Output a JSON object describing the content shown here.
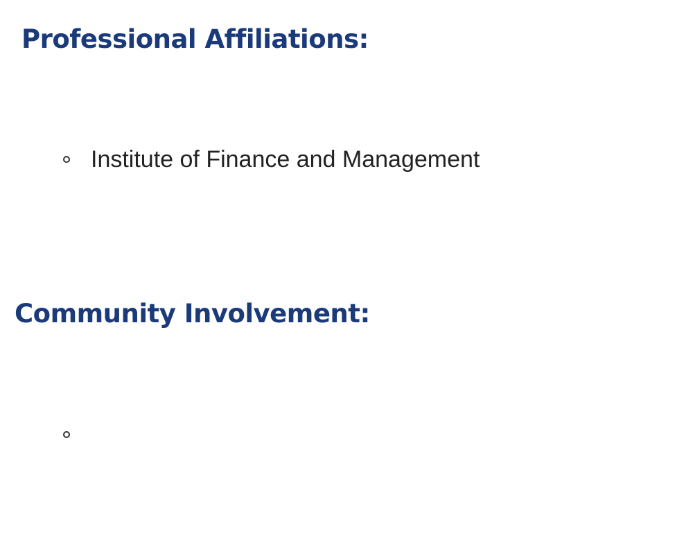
{
  "colors": {
    "heading": "#1b3a7a",
    "body_text": "#222222",
    "bullet": "#333333"
  },
  "sections": [
    {
      "heading": "Professional Affiliations:",
      "items": [
        "Institute of Finance and Management"
      ]
    },
    {
      "heading": "Community Involvement:",
      "items": [
        ""
      ]
    }
  ],
  "icons": {
    "list_bullet": "hollow-circle-bullet-icon"
  }
}
